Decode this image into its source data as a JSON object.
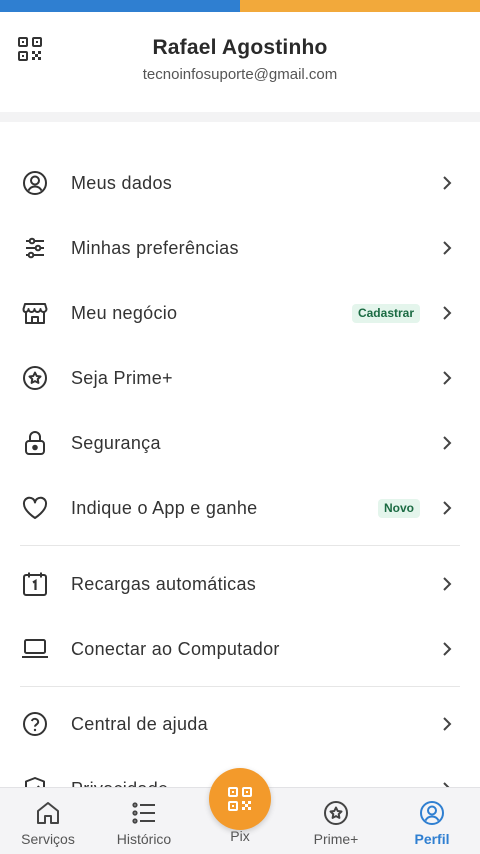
{
  "profile": {
    "name": "Rafael Agostinho",
    "email": "tecnoinfosuporte@gmail.com"
  },
  "menu": {
    "items": [
      {
        "label": "Meus dados",
        "icon": "user-circle-icon"
      },
      {
        "label": "Minhas preferências",
        "icon": "sliders-icon"
      },
      {
        "label": "Meu negócio",
        "icon": "store-icon",
        "badge": "Cadastrar"
      },
      {
        "label": "Seja Prime+",
        "icon": "star-circle-icon"
      },
      {
        "label": "Segurança",
        "icon": "lock-icon"
      },
      {
        "label": "Indique o App e ganhe",
        "icon": "heart-icon",
        "badge": "Novo"
      },
      {
        "label": "Recargas automáticas",
        "icon": "calendar-icon"
      },
      {
        "label": "Conectar ao Computador",
        "icon": "laptop-icon"
      },
      {
        "label": "Central de ajuda",
        "icon": "help-circle-icon"
      },
      {
        "label": "Privacidade",
        "icon": "shield-icon"
      }
    ]
  },
  "nav": {
    "items": [
      {
        "label": "Serviços",
        "icon": "home-icon"
      },
      {
        "label": "Histórico",
        "icon": "list-icon"
      },
      {
        "label": "Pix",
        "icon": "qr-code-icon"
      },
      {
        "label": "Prime+",
        "icon": "star-circle-icon"
      },
      {
        "label": "Perfil",
        "icon": "user-circle-icon",
        "active": true
      }
    ]
  },
  "colors": {
    "accent_blue": "#2f7fd1",
    "accent_orange": "#f39a2b",
    "badge_bg": "#e4f5ec",
    "badge_text": "#1b6b43"
  }
}
